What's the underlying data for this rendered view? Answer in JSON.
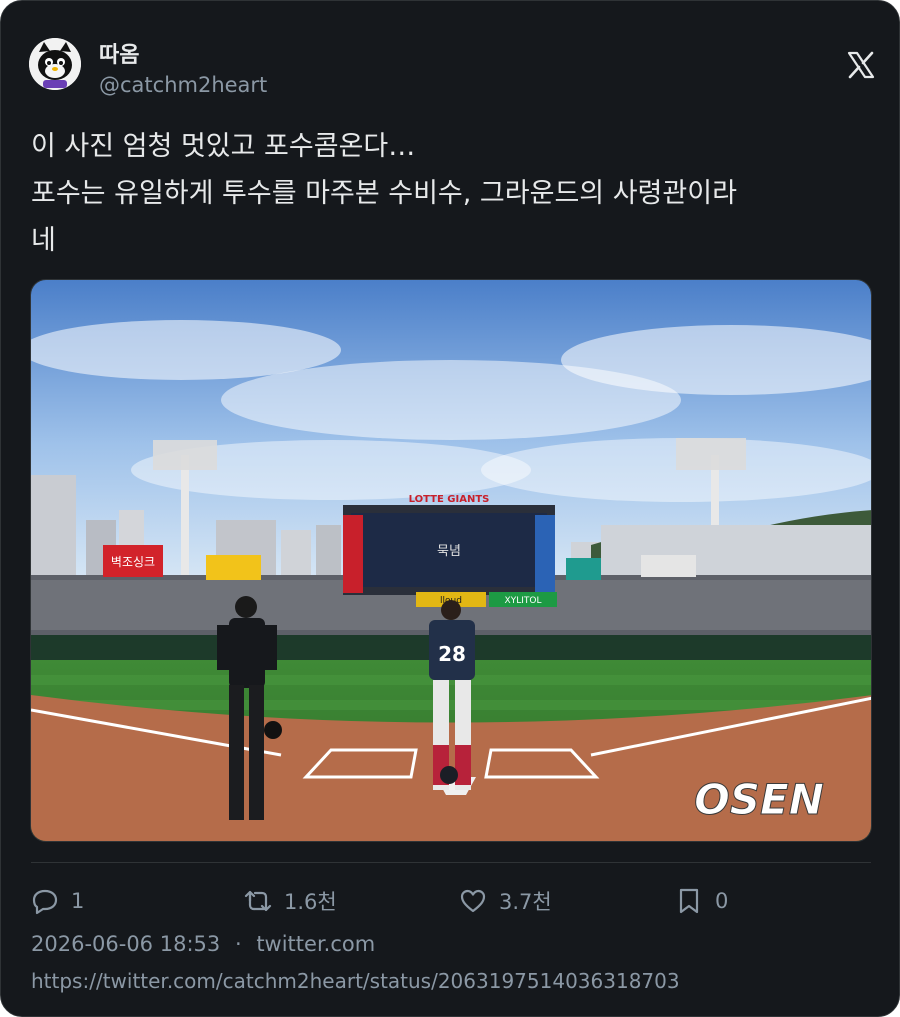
{
  "user": {
    "display_name": "따옴",
    "handle": "@catchm2heart",
    "avatar_icon": "cartoon-character-avatar"
  },
  "platform_icon": "x-logo-icon",
  "tweet": {
    "text": "이 사진 엄청 멋있고 포수콤온다…\n포수는 유일하게 투수를 마주본 수비수, 그라운드의 사령관이라\n네"
  },
  "media": {
    "scoreboard_top": "LOTTE GIANTS",
    "scoreboard_main": "묵념",
    "player_number": "28",
    "watermark": "OSEN",
    "ad_left": "벽조싱크",
    "ad_board_1": "lloud",
    "ad_board_2": "XYLITOL"
  },
  "actions": {
    "reply_count": "1",
    "retweet_count": "1.6천",
    "like_count": "3.7천",
    "bookmark_count": "0"
  },
  "meta": {
    "timestamp": "2026-06-06 18:53",
    "separator": "·",
    "source": "twitter.com",
    "url": "https://twitter.com/catchm2heart/status/2063197514036318703"
  },
  "colors": {
    "background": "#15181c",
    "text_primary": "#e7e9ea",
    "text_secondary": "#8b98a5",
    "border": "#2f3336"
  }
}
